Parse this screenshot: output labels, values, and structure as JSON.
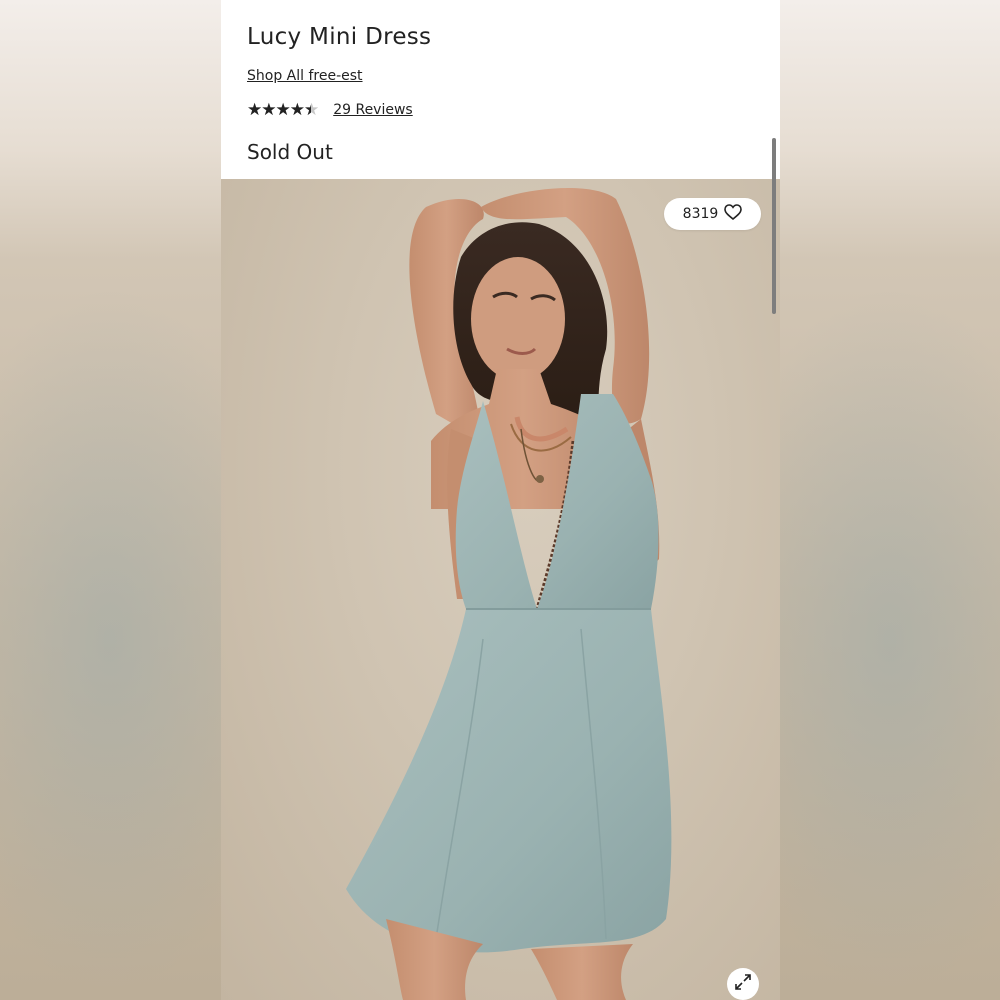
{
  "product": {
    "title": "Lucy Mini Dress",
    "brand_link": "Shop All free-est",
    "rating": 4.5,
    "rating_max": 5,
    "star_glyphs": "★★★★★",
    "reviews_label": "29 Reviews",
    "stock_status": "Sold Out"
  },
  "gallery": {
    "favorites_count": "8319",
    "favorite_icon": "heart-outline-icon",
    "expand_icon": "expand-arrows-icon"
  },
  "colors": {
    "text": "#222222",
    "dress": "#9fb6b5",
    "background": "#cfc3b1"
  }
}
